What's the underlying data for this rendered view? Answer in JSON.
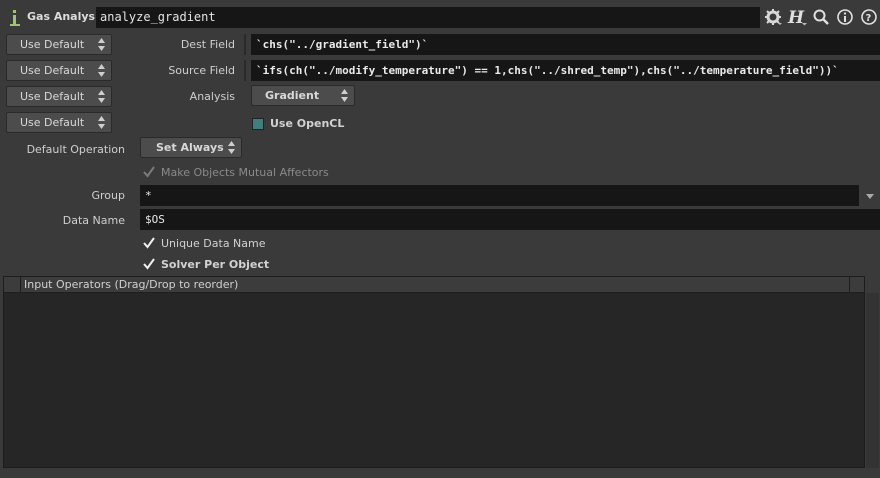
{
  "header": {
    "node_type": "Gas Analysis",
    "node_name": "analyze_gradient",
    "icons": [
      "node-info-icon",
      "gear-icon",
      "help-h-icon",
      "search-icon",
      "info-icon",
      "help-icon"
    ]
  },
  "rows": {
    "dest_field": {
      "menu": "Use Default",
      "label": "Dest Field",
      "value": "`chs(\"../gradient_field\")`"
    },
    "source_field": {
      "menu": "Use Default",
      "label": "Source Field",
      "value": "`ifs(ch(\"../modify_temperature\") == 1,chs(\"../shred_temp\"),chs(\"../temperature_field\"))`"
    },
    "analysis": {
      "menu": "Use Default",
      "label": "Analysis",
      "value": "Gradient"
    },
    "opencl": {
      "menu": "Use Default",
      "label": "Use OpenCL",
      "checked": false
    }
  },
  "default_operation": {
    "label": "Default Operation",
    "value": "Set Always"
  },
  "mutual_affectors": {
    "label": "Make Objects Mutual Affectors",
    "checked": true,
    "enabled": false
  },
  "group": {
    "label": "Group",
    "value": "*"
  },
  "data_name": {
    "label": "Data Name",
    "value": "$OS"
  },
  "unique_data_name": {
    "label": "Unique Data Name",
    "checked": true
  },
  "solver_per_object": {
    "label": "Solver Per Object",
    "checked": true
  },
  "input_operators": {
    "header": "Input Operators (Drag/Drop to reorder)"
  },
  "colors": {
    "bg": "#3a3a3a",
    "field": "#161616",
    "opencl_box": "#3f7f7f"
  }
}
